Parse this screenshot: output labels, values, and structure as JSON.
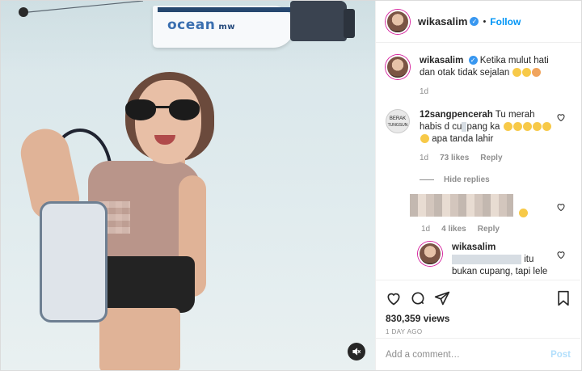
{
  "post": {
    "author": "wikasalim",
    "follow_label": "Follow",
    "dot": "•",
    "verified_mark": "✓"
  },
  "media": {
    "boat_name": "ocean",
    "boat_sub": "mw",
    "mute_icon": "speaker-muted-icon"
  },
  "caption": {
    "username": "wikasalim",
    "text": "Ketika mulut hati dan otak tidak sejalan",
    "time": "1d"
  },
  "comments": [
    {
      "username": "12sangpencerah",
      "text_a": "Tu merah habis d cu",
      "text_b": "pang ka",
      "text_c": "apa tanda lahir",
      "time": "1d",
      "likes": "73 likes",
      "reply": "Reply"
    }
  ],
  "hide_replies_label": "Hide replies",
  "reply_blurred": {
    "time": "1d",
    "likes": "4 likes",
    "reply": "Reply"
  },
  "reply_author": {
    "username": "wikasalim",
    "text_a": "itu",
    "text_b": "bukan cupang, tapi lele"
  },
  "stats": {
    "views": "830,359 views",
    "posted": "1 DAY AGO"
  },
  "composer": {
    "placeholder": "Add a comment…",
    "post_label": "Post"
  }
}
